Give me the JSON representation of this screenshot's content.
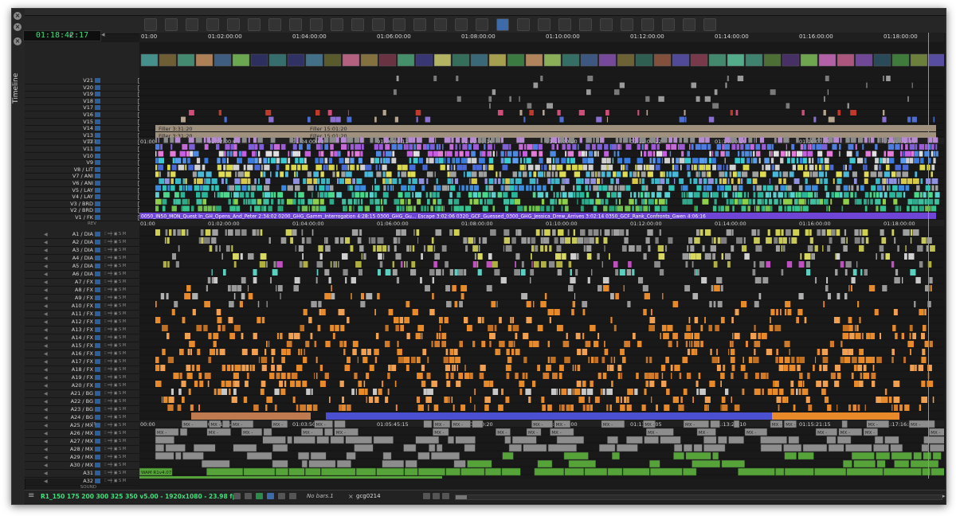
{
  "app": {
    "panel_label": "Timeline"
  },
  "timecode": {
    "value": "01:18:42:17"
  },
  "track_header": {
    "f_label": "F"
  },
  "ruler_top": [
    "01:00",
    "01:02:00:00",
    "01:04:00:00",
    "01:06:00:00",
    "01:08:00:00",
    "01:10:00:00",
    "01:12:00:00",
    "01:14:00:00",
    "01:16:00:00",
    "01:18:00:00"
  ],
  "ruler_mid1": [
    "01:00",
    "01:02:00:04",
    "01:04:00:08",
    "01:06:00:12",
    "01:08:00:16",
    "01:10:00:20",
    "01:12:00:22",
    "01:14:00:26",
    "01:16:00:00",
    "01:18:01:04"
  ],
  "ruler_mid2": [
    "01:00",
    "01:02:00:00",
    "01:04:00:00",
    "01:06:00:00",
    "01:08:00:00",
    "01:10:00:00",
    "01:12:00:00",
    "01:14:00:00",
    "01:16:00:00",
    "01:18:00:00"
  ],
  "ruler_audio": [
    "00:00",
    "01:01:55:05",
    "01:03:50:10",
    "01:05:45:15",
    "01:07:40:20",
    "01:09:36:00",
    "01:11:31:05",
    "01:13:26:10",
    "01:15:21:15",
    "01:17:16:20"
  ],
  "ruler_bottom": [
    "01:00",
    "01:02:00:00",
    "01:04:00:00",
    "01:06:00:00",
    "01:08:00:00",
    "01:10:00:00",
    "01:12:00:00",
    "01:14:00:00",
    "01:16:00:00",
    "01:18:00:00"
  ],
  "ruler_labels": {
    "tc1": "TC1",
    "rev": "REV",
    "pos25": "25",
    "sound": "SOUND"
  },
  "video_tracks": [
    "V21",
    "V20",
    "V19",
    "V18",
    "V17",
    "V16",
    "V15",
    "V14",
    "V13",
    "V12",
    "V11",
    "V10",
    "V9",
    "V8 / LIT",
    "V7 / ANI",
    "V6 / ANI",
    "V5 / LAY",
    "V4 / LAY",
    "V3 / BRD",
    "V2 / BRD",
    "V1 / FK"
  ],
  "audio_tracks": [
    "A1 / DIA",
    "A2 / DIA",
    "A3 / DIA",
    "A4 / DIA",
    "A5 / DIA",
    "A6 / DIA",
    "A7 / FX",
    "A8 / FX",
    "A9 / FX",
    "A10 / FX",
    "A11 / FX",
    "A12 / FX",
    "A13 / FX",
    "A14 / FX",
    "A15 / FX",
    "A16 / FX",
    "A17 / FX",
    "A18 / FX",
    "A19 / FX",
    "A20 / FX",
    "A21 / BG",
    "A22 / BG",
    "A23 / BG",
    "A24 / BG",
    "A25 / MX",
    "A26 / MX",
    "A27 / MX",
    "A28 / MX",
    "A29 / MX",
    "A30 / MX",
    "A31",
    "A32"
  ],
  "filler_labels": [
    "Filler 3:31:20",
    "Filler 15:01:20"
  ],
  "v1_label": "0050_IN50_MON_Quest In_GH_Opens_And_Peter 2:34:02    0200_GHG_Gamm_Interrogation 4:28:15    0300_GHG_Gu... Escape 3:02:06    0320_GCF_Guessed_0300_GHG_Jessica_Drew_Arrives 3:02:14    0350_GCF_Rank_Confronts_Gwen 4:06:16",
  "mx_clip_prefix": "MX -",
  "wam_label": "WAM R1v4.07 Opening",
  "status_bar": {
    "format": "R1_150 175 200 300 325 350 v5.00 - 1920x1080 - 23.98 fps",
    "no_bars": "No bars.1",
    "sequence": "gcg0214"
  },
  "colors": {
    "playhead": "#2fb7e8",
    "v1_clip": "#6f45d6",
    "fx_orange": "#e88a2a",
    "mx_gray": "#8d8d8d",
    "a31_green": "#56a33a",
    "sound_blue": "#4b4fd1",
    "timecode_green": "#3fe07a"
  }
}
